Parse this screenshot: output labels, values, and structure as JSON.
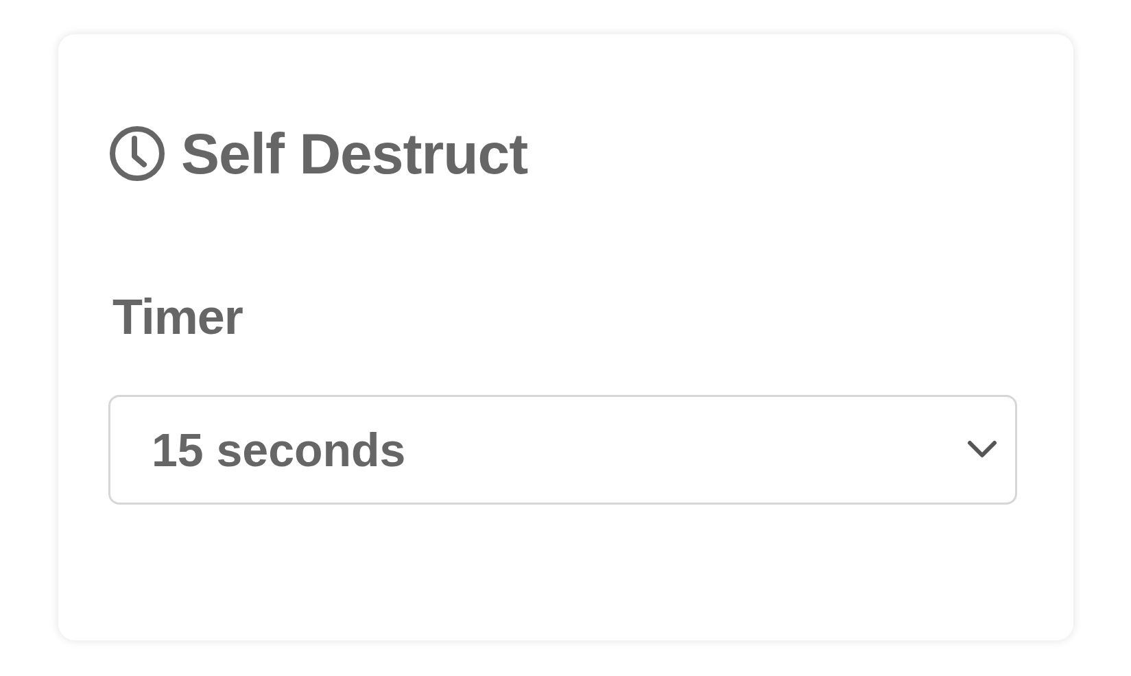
{
  "card": {
    "title": "Self Destruct",
    "timer": {
      "label": "Timer",
      "value": "15 seconds"
    }
  }
}
